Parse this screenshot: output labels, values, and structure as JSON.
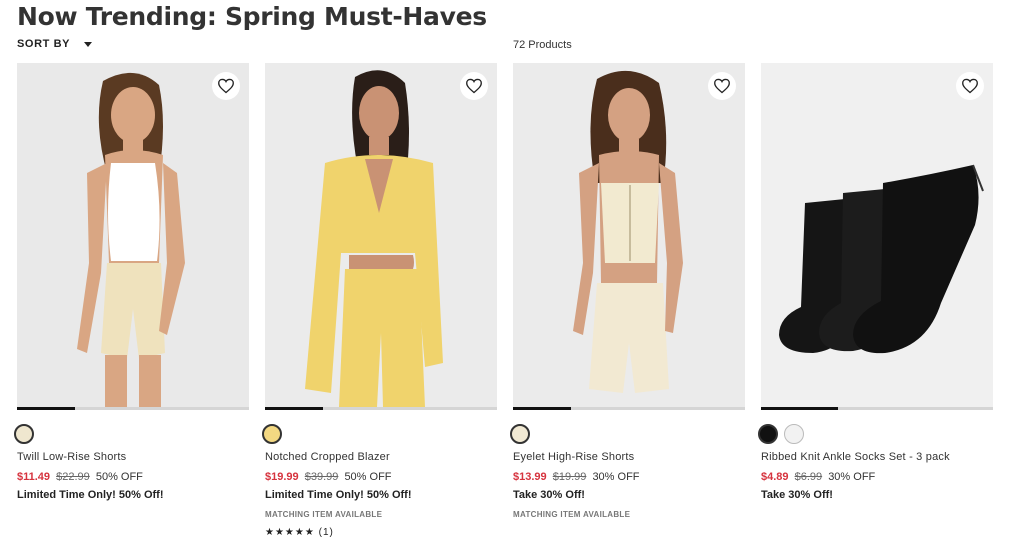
{
  "page": {
    "title": "Now Trending: Spring Must-Haves",
    "sort_label": "SORT BY",
    "product_count": "72 Products"
  },
  "products": [
    {
      "name": "Twill Low-Rise Shorts",
      "sale_price": "$11.49",
      "original_price": "$22.99",
      "discount": "50% OFF",
      "promo": "Limited Time Only! 50% Off!",
      "swatches": [
        "#efe7cf"
      ],
      "extra": ""
    },
    {
      "name": "Notched Cropped Blazer",
      "sale_price": "$19.99",
      "original_price": "$39.99",
      "discount": "50% OFF",
      "promo": "Limited Time Only! 50% Off!",
      "swatches": [
        "#f3d882"
      ],
      "extra": "MATCHING ITEM AVAILABLE",
      "rating_stars": "★★★★★",
      "rating_count": "(1)"
    },
    {
      "name": "Eyelet High-Rise Shorts",
      "sale_price": "$13.99",
      "original_price": "$19.99",
      "discount": "30% OFF",
      "promo": "Take 30% Off!",
      "swatches": [
        "#f1e9d3"
      ],
      "extra": "MATCHING ITEM AVAILABLE"
    },
    {
      "name": "Ribbed Knit Ankle Socks Set - 3 pack",
      "sale_price": "$4.89",
      "original_price": "$6.99",
      "discount": "30% OFF",
      "promo": "Take 30% Off!",
      "swatches": [
        "#111111",
        "#f2f2f2"
      ],
      "extra": ""
    }
  ],
  "colors": {
    "sale": "#d6333e",
    "image_bg": "#ececec"
  },
  "icons": {
    "favorite": "heart-outline-icon",
    "sort": "caret-down-icon"
  }
}
